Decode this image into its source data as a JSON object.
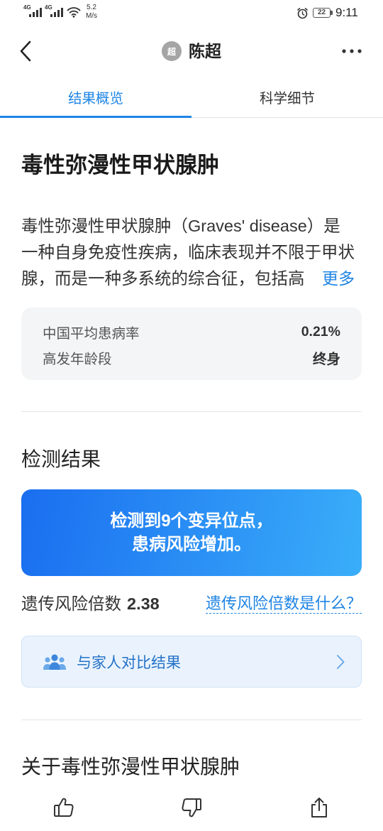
{
  "status_bar": {
    "signal_1_label": "4G",
    "signal_2_label": "4G",
    "speed_value": "5.2",
    "speed_unit": "M/s",
    "battery_level": "22",
    "time": "9:11",
    "icons": [
      "signal-icon",
      "signal-icon",
      "wifi-icon",
      "alarm-icon",
      "battery-icon"
    ]
  },
  "header": {
    "back_icon": "chevron-left-icon",
    "avatar_text": "超",
    "user_name": "陈超",
    "more_icon": "more-horizontal-icon"
  },
  "tabs": [
    {
      "label": "结果概览",
      "active": true
    },
    {
      "label": "科学细节",
      "active": false
    }
  ],
  "report": {
    "title": "毒性弥漫性甲状腺肿",
    "description_lines": [
      "毒性弥漫性甲状腺肿（Graves' disease）是",
      "一种自身免疫性疾病，临床表现并不限于甲状",
      "腺，而是一种多系统的综合征，包括高"
    ],
    "more_label": "更多",
    "stats": [
      {
        "label": "中国平均患病率",
        "value": "0.21%"
      },
      {
        "label": "高发年龄段",
        "value": "终身"
      }
    ]
  },
  "result": {
    "section_title": "检测结果",
    "banner_line1": "检测到9个变异位点，",
    "banner_line2": "患病风险增加。",
    "risk_label": "遗传风险倍数",
    "risk_value": "2.38",
    "risk_help_link": "遗传风险倍数是什么？",
    "family_icon": "family-icon",
    "family_compare_label": "与家人对比结果",
    "family_chevron_icon": "chevron-right-icon"
  },
  "about": {
    "title": "关于毒性弥漫性甲状腺肿"
  },
  "bottom_bar": {
    "icons": [
      "thumbs-up-icon",
      "thumbs-down-icon",
      "share-icon"
    ]
  },
  "colors": {
    "accent": "#1e84e4",
    "text": "#222222",
    "muted": "#555555",
    "card_background": "#f4f5f7",
    "banner_gradient_start": "#1a6ef0",
    "banner_gradient_end": "#3aaef9",
    "family_button_background": "#eaf3fd",
    "family_button_text": "#2372c7"
  }
}
